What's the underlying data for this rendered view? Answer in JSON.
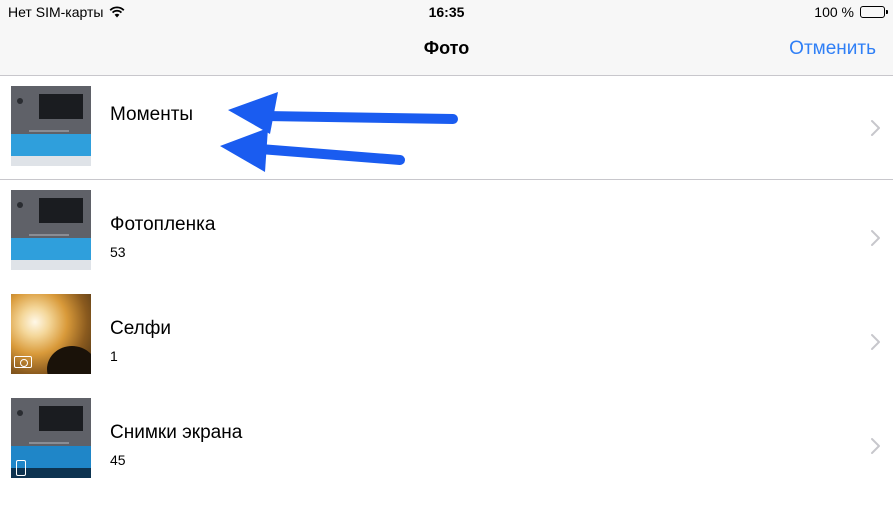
{
  "status": {
    "carrier": "Нет SIM-карты",
    "time": "16:35",
    "battery": "100 %"
  },
  "nav": {
    "title": "Фото",
    "cancel": "Отменить"
  },
  "albums": [
    {
      "title": "Моменты",
      "count": ""
    },
    {
      "title": "Фотопленка",
      "count": "53"
    },
    {
      "title": "Селфи",
      "count": "1"
    },
    {
      "title": "Снимки экрана",
      "count": "45"
    }
  ],
  "colors": {
    "accent": "#2f7ff6",
    "annotation_arrow": "#1a5cf0",
    "separator": "#c8c7cc"
  },
  "icons": [
    "wifi-icon",
    "battery-icon",
    "chevron-right-icon",
    "camera-icon",
    "phone-icon"
  ]
}
